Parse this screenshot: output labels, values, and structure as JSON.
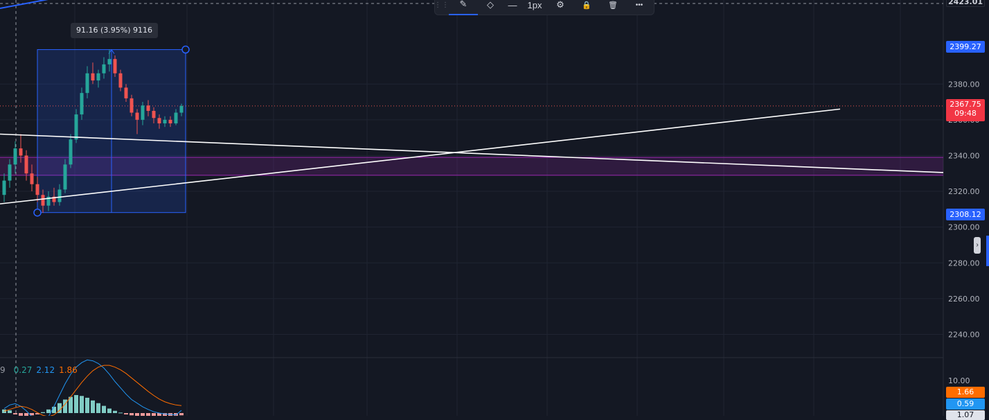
{
  "toolbar": {
    "items": [
      {
        "name": "pencil-icon",
        "glyph": "✎"
      },
      {
        "name": "fill-color-icon",
        "glyph": "◇"
      },
      {
        "name": "line-style-icon",
        "glyph": "—"
      },
      {
        "name": "line-width-label",
        "label": "1px"
      },
      {
        "name": "settings-icon",
        "glyph": "⚙"
      },
      {
        "name": "lock-icon",
        "glyph": "🔒"
      },
      {
        "name": "trash-icon",
        "glyph": "🗑"
      },
      {
        "name": "more-icon",
        "glyph": "•••"
      }
    ]
  },
  "measure": {
    "label": "91.16 (3.95%) 9116",
    "start_price": 2308.12,
    "end_price": 2399.27
  },
  "price_scale": {
    "ticks": [
      "2380.00",
      "2360.00",
      "2340.00",
      "2320.00",
      "2300.00",
      "2280.00",
      "2260.00",
      "2240.00"
    ],
    "top_label": "2423.01"
  },
  "tags": {
    "upper_measure": "2399.27",
    "current_price": "2367.75",
    "countdown": "09:48",
    "lower_measure": "2308.12",
    "macd_top": "10.00",
    "macd_signal": "1.66",
    "macd_line": "0.59",
    "macd_bottom": "1.07"
  },
  "macd_legend": {
    "param": "9",
    "histogram": "0.27",
    "macd": "2.12",
    "signal": "1.86"
  },
  "colors": {
    "background": "#141823",
    "grid": "#1f2432",
    "bull": "#26a69a",
    "bear": "#ef5350",
    "measure_box": "#2962ff",
    "zone": "#9c27b0",
    "trendline": "#ffffff",
    "macd_line": "#2196f3",
    "signal_line": "#ff6d00",
    "hist_bull": "#80cbc4",
    "hist_bear": "#ef9a9a"
  },
  "chart_data": {
    "type": "candlestick",
    "y_range": [
      2227,
      2427
    ],
    "zone": [
      2329,
      2339
    ],
    "current_price": 2367.75,
    "candles": [
      [
        2318,
        2330,
        2314,
        2326
      ],
      [
        2326,
        2338,
        2322,
        2335
      ],
      [
        2335,
        2348,
        2330,
        2344
      ],
      [
        2344,
        2352,
        2336,
        2340
      ],
      [
        2340,
        2343,
        2326,
        2330
      ],
      [
        2330,
        2335,
        2320,
        2324
      ],
      [
        2324,
        2328,
        2314,
        2318
      ],
      [
        2318,
        2321,
        2308,
        2312
      ],
      [
        2312,
        2320,
        2309,
        2317
      ],
      [
        2317,
        2322,
        2312,
        2314
      ],
      [
        2314,
        2324,
        2312,
        2321
      ],
      [
        2321,
        2338,
        2319,
        2335
      ],
      [
        2335,
        2352,
        2333,
        2349
      ],
      [
        2349,
        2366,
        2347,
        2363
      ],
      [
        2363,
        2378,
        2360,
        2375
      ],
      [
        2375,
        2390,
        2372,
        2386
      ],
      [
        2386,
        2392,
        2380,
        2382
      ],
      [
        2382,
        2388,
        2378,
        2386
      ],
      [
        2386,
        2395,
        2383,
        2391
      ],
      [
        2391,
        2399.27,
        2387,
        2394
      ],
      [
        2394,
        2396,
        2384,
        2386
      ],
      [
        2386,
        2388,
        2376,
        2378
      ],
      [
        2378,
        2380,
        2370,
        2372
      ],
      [
        2372,
        2374,
        2362,
        2364
      ],
      [
        2364,
        2366,
        2352,
        2360
      ],
      [
        2360,
        2370,
        2357,
        2368
      ],
      [
        2368,
        2371,
        2362,
        2365
      ],
      [
        2365,
        2367,
        2358,
        2361
      ],
      [
        2361,
        2363,
        2355,
        2358
      ],
      [
        2358,
        2362,
        2356,
        2360
      ],
      [
        2360,
        2362,
        2356,
        2358
      ],
      [
        2358,
        2366,
        2357,
        2364
      ],
      [
        2364,
        2369,
        2362,
        2367.75
      ]
    ],
    "histogram": [
      0.8,
      0.6,
      -0.3,
      -0.6,
      -0.8,
      -0.5,
      -0.3,
      0.2,
      0.8,
      1.4,
      2.2,
      3.0,
      3.6,
      4.0,
      3.8,
      3.4,
      2.8,
      2.2,
      1.6,
      1.0,
      0.5,
      0.1,
      -0.3,
      -0.5,
      -0.7,
      -0.9,
      -1.0,
      -1.0,
      -0.9,
      -0.8,
      -0.7,
      -0.6,
      -0.5
    ],
    "macd_line": [
      1.0,
      1.8,
      2.1,
      1.5,
      0.5,
      -0.8,
      -1.6,
      -1.8,
      -0.8,
      1.5,
      4.0,
      6.5,
      8.6,
      10.2,
      11.2,
      11.8,
      11.6,
      11.0,
      10.0,
      8.6,
      7.0,
      5.6,
      4.2,
      3.0,
      2.2,
      1.4,
      0.8,
      0.3,
      0.0,
      -0.2,
      -0.3,
      -0.4,
      0.59
    ],
    "signal_line": [
      0.4,
      0.8,
      1.2,
      1.5,
      1.3,
      0.8,
      0.1,
      -0.5,
      -0.8,
      -0.4,
      0.6,
      2.0,
      3.6,
      5.2,
      6.8,
      8.2,
      9.4,
      10.2,
      10.6,
      10.6,
      10.2,
      9.6,
      8.8,
      7.8,
      6.8,
      5.8,
      4.8,
      3.9,
      3.1,
      2.5,
      2.1,
      1.8,
      1.66
    ]
  }
}
